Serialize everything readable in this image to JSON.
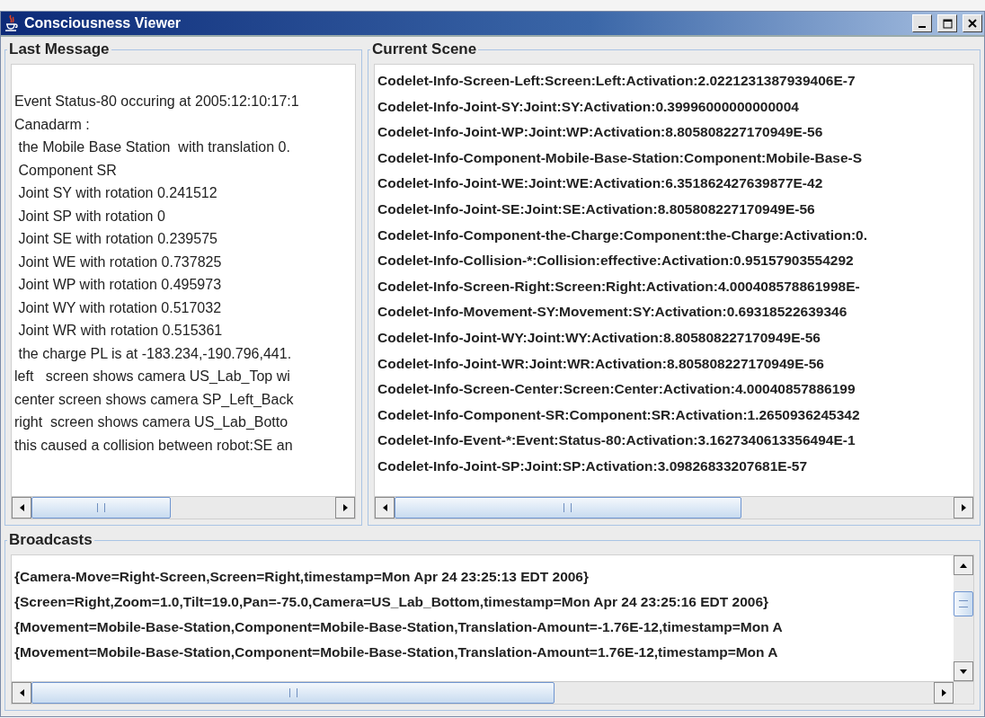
{
  "window": {
    "title": "Consciousness Viewer"
  },
  "last_message": {
    "title": "Last Message",
    "lines": [
      "Event Status-80 occuring at 2005:12:10:17:1",
      "Canadarm :",
      " the Mobile Base Station  with translation 0.",
      " Component SR",
      " Joint SY with rotation 0.241512",
      " Joint SP with rotation 0",
      " Joint SE with rotation 0.239575",
      " Joint WE with rotation 0.737825",
      " Joint WP with rotation 0.495973",
      " Joint WY with rotation 0.517032",
      " Joint WR with rotation 0.515361",
      " the charge PL is at -183.234,-190.796,441.",
      "left   screen shows camera US_Lab_Top wi",
      "center screen shows camera SP_Left_Back",
      "right  screen shows camera US_Lab_Botto",
      "this caused a collision between robot:SE an"
    ]
  },
  "current_scene": {
    "title": "Current Scene",
    "lines": [
      "Codelet-Info-Screen-Left:Screen:Left:Activation:2.0221231387939406E-7",
      "Codelet-Info-Joint-SY:Joint:SY:Activation:0.39996000000000004",
      "Codelet-Info-Joint-WP:Joint:WP:Activation:8.805808227170949E-56",
      "Codelet-Info-Component-Mobile-Base-Station:Component:Mobile-Base-S",
      "Codelet-Info-Joint-WE:Joint:WE:Activation:6.351862427639877E-42",
      "Codelet-Info-Joint-SE:Joint:SE:Activation:8.805808227170949E-56",
      "Codelet-Info-Component-the-Charge:Component:the-Charge:Activation:0.",
      "Codelet-Info-Collision-*:Collision:effective:Activation:0.95157903554292",
      "Codelet-Info-Screen-Right:Screen:Right:Activation:4.000408578861998E-",
      "Codelet-Info-Movement-SY:Movement:SY:Activation:0.69318522639346",
      "Codelet-Info-Joint-WY:Joint:WY:Activation:8.805808227170949E-56",
      "Codelet-Info-Joint-WR:Joint:WR:Activation:8.805808227170949E-56",
      "Codelet-Info-Screen-Center:Screen:Center:Activation:4.00040857886199",
      "Codelet-Info-Component-SR:Component:SR:Activation:1.2650936245342",
      "Codelet-Info-Event-*:Event:Status-80:Activation:3.1627340613356494E-1",
      "Codelet-Info-Joint-SP:Joint:SP:Activation:3.09826833207681E-57"
    ]
  },
  "broadcasts": {
    "title": "Broadcasts",
    "lines": [
      "{Camera-Move=Right-Screen,Screen=Right,timestamp=Mon Apr 24 23:25:13 EDT 2006}",
      "{Screen=Right,Zoom=1.0,Tilt=19.0,Pan=-75.0,Camera=US_Lab_Bottom,timestamp=Mon Apr 24 23:25:16 EDT 2006}",
      "{Movement=Mobile-Base-Station,Component=Mobile-Base-Station,Translation-Amount=-1.76E-12,timestamp=Mon A",
      "{Movement=Mobile-Base-Station,Component=Mobile-Base-Station,Translation-Amount=1.76E-12,timestamp=Mon A"
    ]
  }
}
